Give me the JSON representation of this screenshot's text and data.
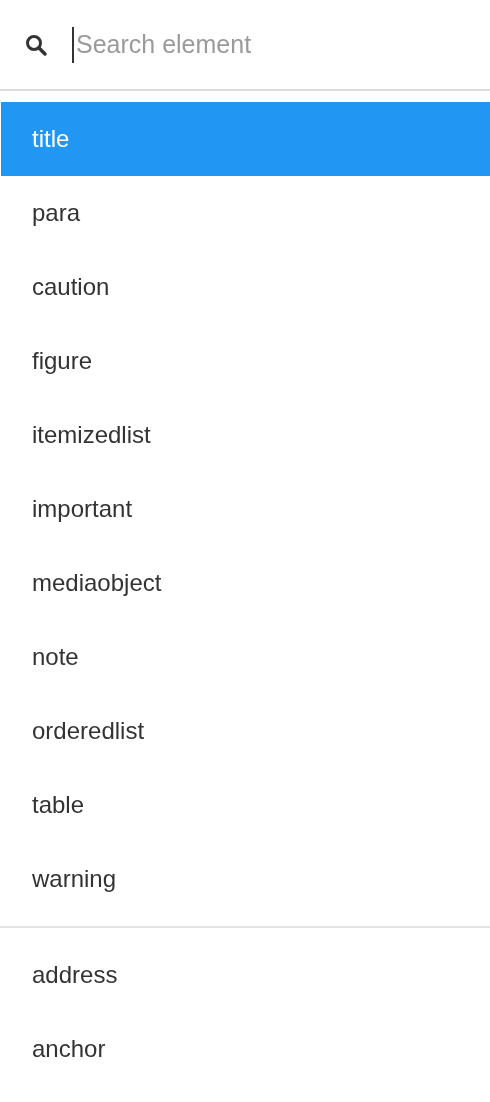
{
  "search": {
    "placeholder": "Search element"
  },
  "groups": [
    {
      "items": [
        {
          "label": "title",
          "selected": true
        },
        {
          "label": "para",
          "selected": false
        },
        {
          "label": "caution",
          "selected": false
        },
        {
          "label": "figure",
          "selected": false
        },
        {
          "label": "itemizedlist",
          "selected": false
        },
        {
          "label": "important",
          "selected": false
        },
        {
          "label": "mediaobject",
          "selected": false
        },
        {
          "label": "note",
          "selected": false
        },
        {
          "label": "orderedlist",
          "selected": false
        },
        {
          "label": "table",
          "selected": false
        },
        {
          "label": "warning",
          "selected": false
        }
      ]
    },
    {
      "items": [
        {
          "label": "address",
          "selected": false
        },
        {
          "label": "anchor",
          "selected": false
        }
      ]
    }
  ]
}
